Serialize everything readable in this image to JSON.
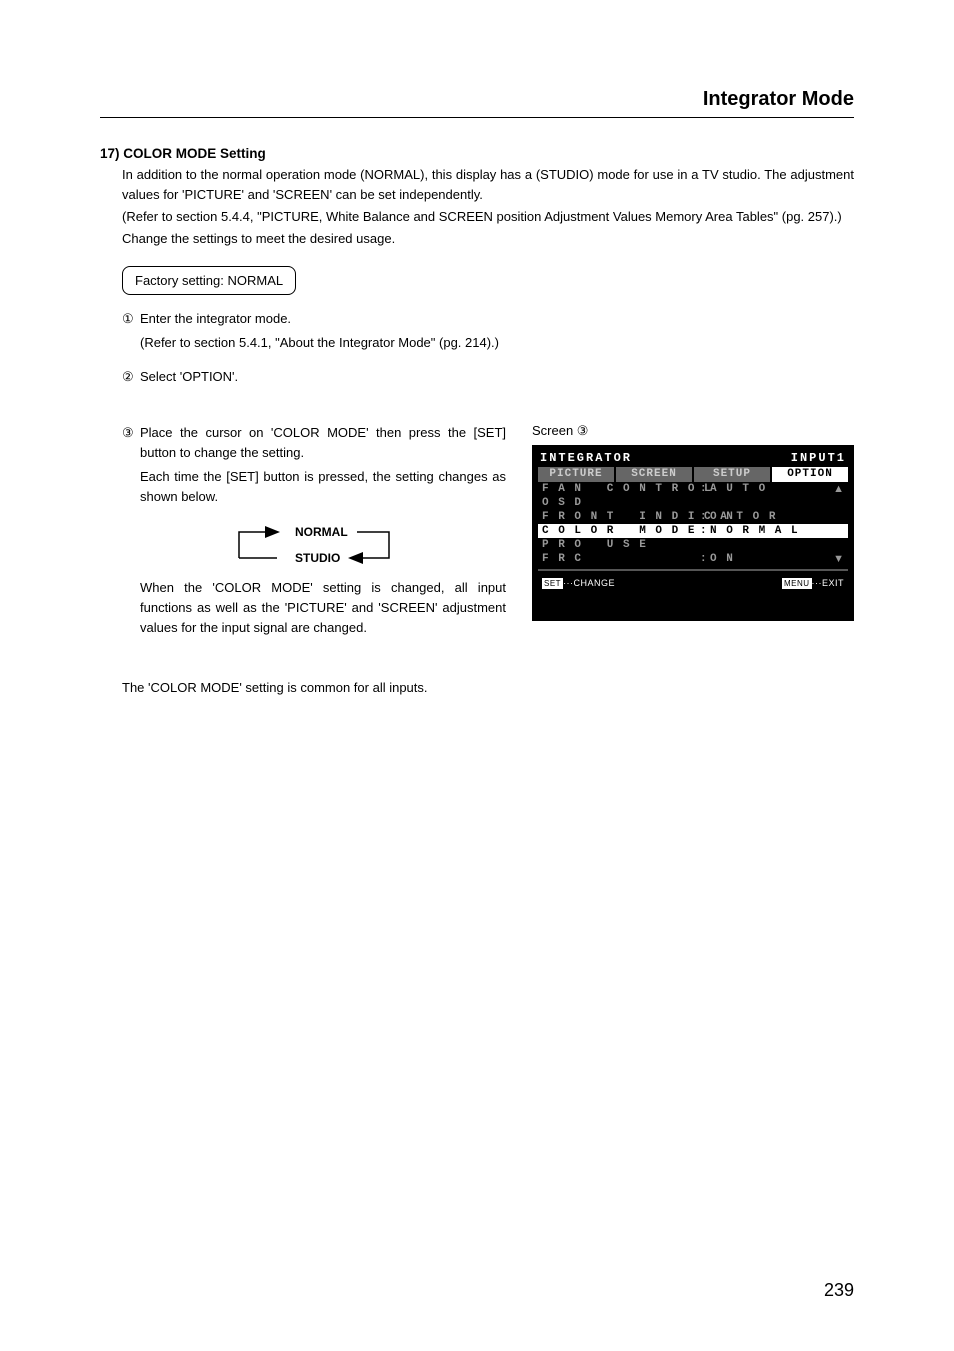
{
  "section_title": "Integrator Mode",
  "heading": "17) COLOR MODE Setting",
  "intro_p1": "In addition to the normal operation mode (NORMAL), this display has a (STUDIO) mode for use in a TV studio. The adjustment values for 'PICTURE' and 'SCREEN' can be set independently.",
  "intro_p2": "(Refer to section 5.4.4, \"PICTURE, White Balance and SCREEN position Adjustment Values Memory Area Tables\" (pg. 257).)",
  "intro_p3": "Change the settings to meet the desired usage.",
  "factory": "Factory setting: NORMAL",
  "step1": {
    "num": "①",
    "text": "Enter the integrator mode.",
    "sub": "(Refer to section 5.4.1, \"About the Integrator Mode\" (pg. 214).)"
  },
  "step2": {
    "num": "②",
    "text": "Select 'OPTION'."
  },
  "step3": {
    "num": "③",
    "text": "Place the cursor on 'COLOR MODE' then press the [SET] button to change the setting.",
    "sub": "Each time the [SET] button is pressed, the setting changes as shown below."
  },
  "toggle": {
    "top": "NORMAL",
    "bottom": "STUDIO"
  },
  "note1": "When the 'COLOR MODE' setting is changed, all input functions as well as the 'PICTURE' and 'SCREEN' adjustment values for the input signal are changed.",
  "note2": "The 'COLOR MODE' setting is common for all inputs.",
  "screen_label": "Screen ③",
  "osd": {
    "title": "INTEGRATOR",
    "input": "INPUT1",
    "tabs": [
      "PICTURE",
      "SCREEN",
      "SETUP",
      "OPTION"
    ],
    "active_tab": 3,
    "lines": [
      {
        "label": "FAN CONTROL",
        "value": "AUTO",
        "colon": ":",
        "arrow": "▲"
      },
      {
        "label": "OSD",
        "value": "",
        "colon": ""
      },
      {
        "label": "FRONT INDICATOR",
        "value": "ON",
        "colon": ":"
      },
      {
        "label": "COLOR MODE",
        "value": "NORMAL",
        "colon": ":",
        "highlight": true
      },
      {
        "label": "PRO USE",
        "value": "",
        "colon": ""
      },
      {
        "label": "FRC",
        "value": "ON",
        "colon": ":",
        "arrow": "▼"
      }
    ],
    "bottom_set": "SET",
    "bottom_change": "···CHANGE",
    "bottom_menu": "MENU",
    "bottom_exit": "···EXIT"
  },
  "page_number": "239"
}
